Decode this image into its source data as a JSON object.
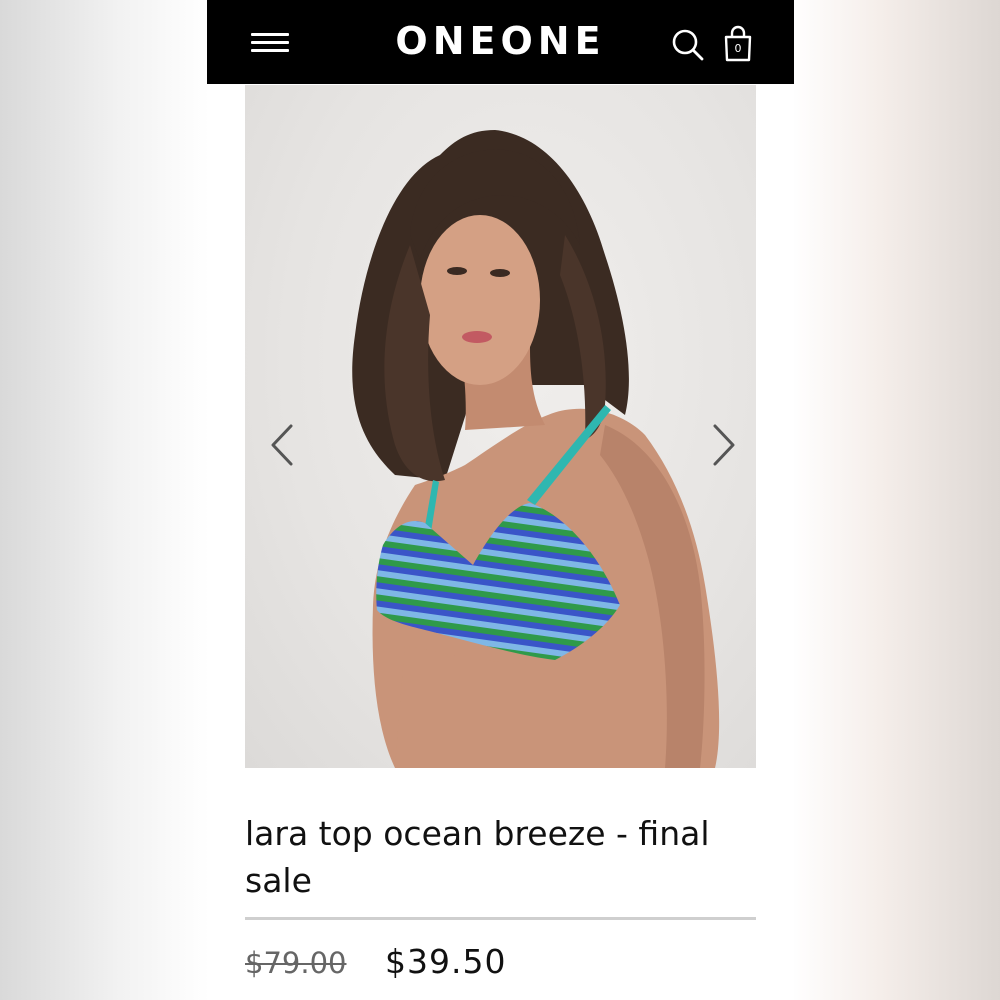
{
  "header": {
    "brand": "ONEONE",
    "menu_icon": "hamburger-menu-icon",
    "search_icon": "search-icon",
    "cart_icon": "shopping-bag-icon",
    "cart_count": "0",
    "background": "#000000"
  },
  "gallery": {
    "image_description_icon": "product-photo",
    "prev_icon": "chevron-left-icon",
    "next_icon": "chevron-right-icon"
  },
  "product": {
    "title": "lara top ocean breeze - final sale",
    "original_price": "$79.00",
    "sale_price": "$39.50"
  },
  "colors": {
    "stripe_green": "#2f9a4a",
    "stripe_blue": "#3a55c8",
    "stripe_light": "#7fb7e6",
    "strap_teal": "#2fb7b0"
  }
}
